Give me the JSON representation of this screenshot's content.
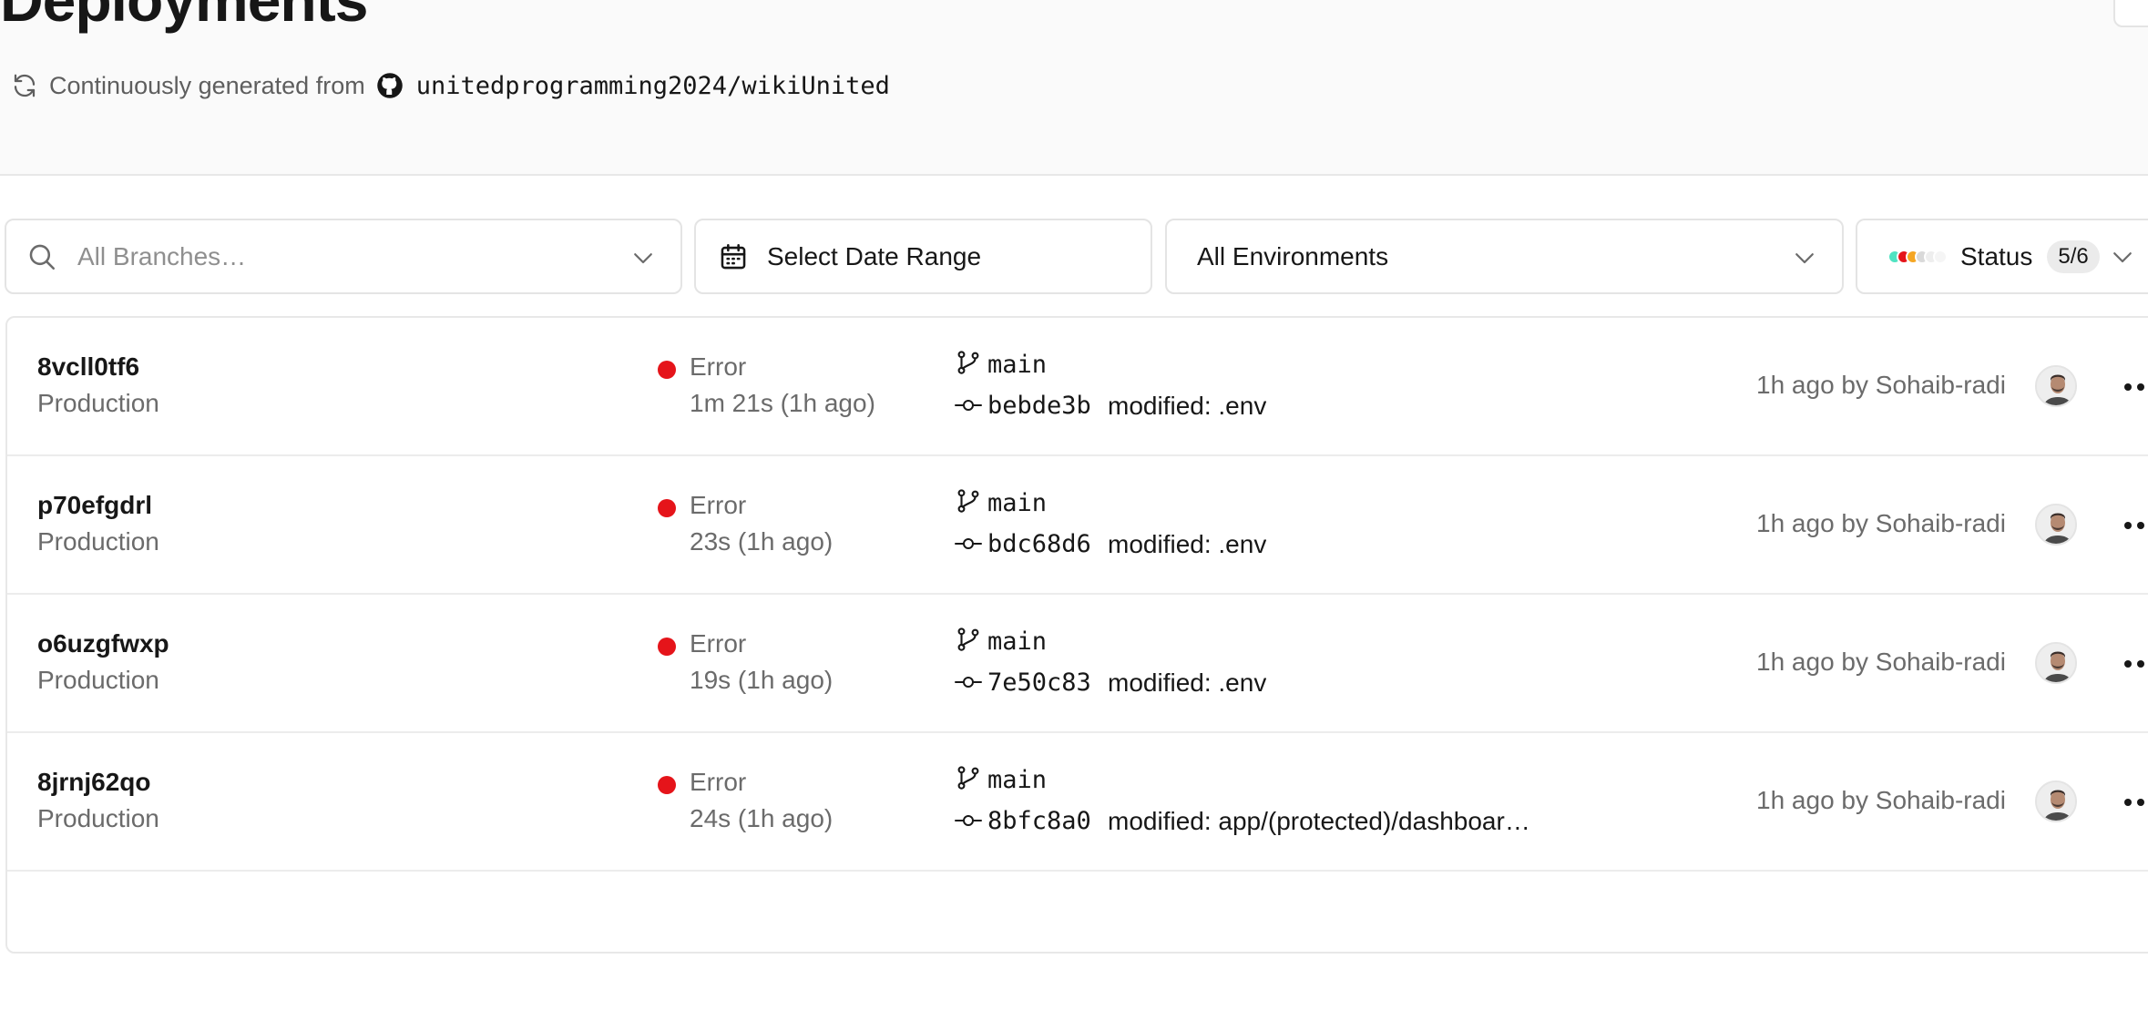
{
  "header": {
    "title": "Deployments",
    "source_prefix": "Continuously generated from",
    "repo": "unitedprogramming2024/wikiUnited",
    "icons": {
      "refresh": "refresh-icon",
      "github": "github-icon"
    }
  },
  "filters": {
    "branches": {
      "placeholder": "All Branches…",
      "icon": "search-icon"
    },
    "date": {
      "label": "Select Date Range",
      "icon": "calendar-icon"
    },
    "environments": {
      "label": "All Environments"
    },
    "status": {
      "label": "Status",
      "count": "5/6"
    }
  },
  "colors": {
    "error": "#e5141a",
    "status_dots": [
      "#50e3c2",
      "#e5141a",
      "#f5a623",
      "#d9d9d9",
      "#eeeeee",
      "#f5f5f5"
    ]
  },
  "deployments": [
    {
      "id": "8vcll0tf6",
      "environment": "Production",
      "status": "Error",
      "duration": "1m 21s (1h ago)",
      "branch": "main",
      "commit": "bebde3b",
      "message": "modified: .env",
      "age": "1h ago by Sohaib-radi"
    },
    {
      "id": "p70efgdrl",
      "environment": "Production",
      "status": "Error",
      "duration": "23s (1h ago)",
      "branch": "main",
      "commit": "bdc68d6",
      "message": "modified: .env",
      "age": "1h ago by Sohaib-radi"
    },
    {
      "id": "o6uzgfwxp",
      "environment": "Production",
      "status": "Error",
      "duration": "19s (1h ago)",
      "branch": "main",
      "commit": "7e50c83",
      "message": "modified: .env",
      "age": "1h ago by Sohaib-radi"
    },
    {
      "id": "8jrnj62qo",
      "environment": "Production",
      "status": "Error",
      "duration": "24s (1h ago)",
      "branch": "main",
      "commit": "8bfc8a0",
      "message": "modified: app/(protected)/dashboar…",
      "age": "1h ago by Sohaib-radi"
    }
  ]
}
